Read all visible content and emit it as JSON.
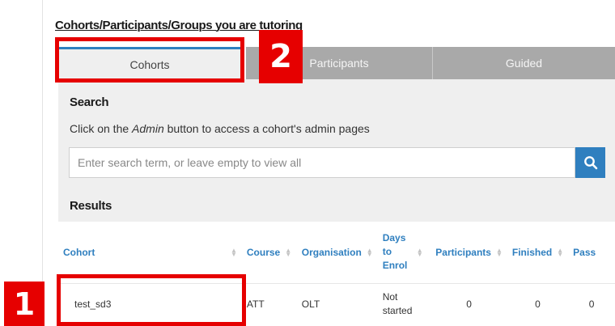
{
  "section": {
    "title": "Cohorts/Participants/Groups you are tutoring"
  },
  "tabs": [
    {
      "label": "Cohorts",
      "active": true
    },
    {
      "label": "Participants",
      "active": false
    },
    {
      "label": "Guided",
      "active": false
    }
  ],
  "search": {
    "heading": "Search",
    "instructions_before": "Click on the ",
    "instructions_emphasis": "Admin",
    "instructions_after": " button to access a cohort's admin pages",
    "placeholder": "Enter search term, or leave empty to view all",
    "value": "",
    "button_icon": "search-icon"
  },
  "results": {
    "heading": "Results",
    "columns": [
      "Cohort",
      "Course",
      "Organisation",
      "Days to Enrol",
      "Participants",
      "Finished",
      "Pass"
    ],
    "rows": [
      {
        "cohort": "test_sd3",
        "course": "ATT",
        "organisation": "OLT",
        "days_to_enrol": "Not started",
        "participants": "0",
        "finished": "0",
        "pass": "0"
      }
    ]
  },
  "annotations": [
    {
      "number": "1",
      "target": "cohort-cell"
    },
    {
      "number": "2",
      "target": "tab-cohorts"
    }
  ],
  "colors": {
    "accent": "#2f7fbf",
    "callout": "#e60000",
    "inactive_tab": "#a9a9a9",
    "panel": "#efefef"
  }
}
